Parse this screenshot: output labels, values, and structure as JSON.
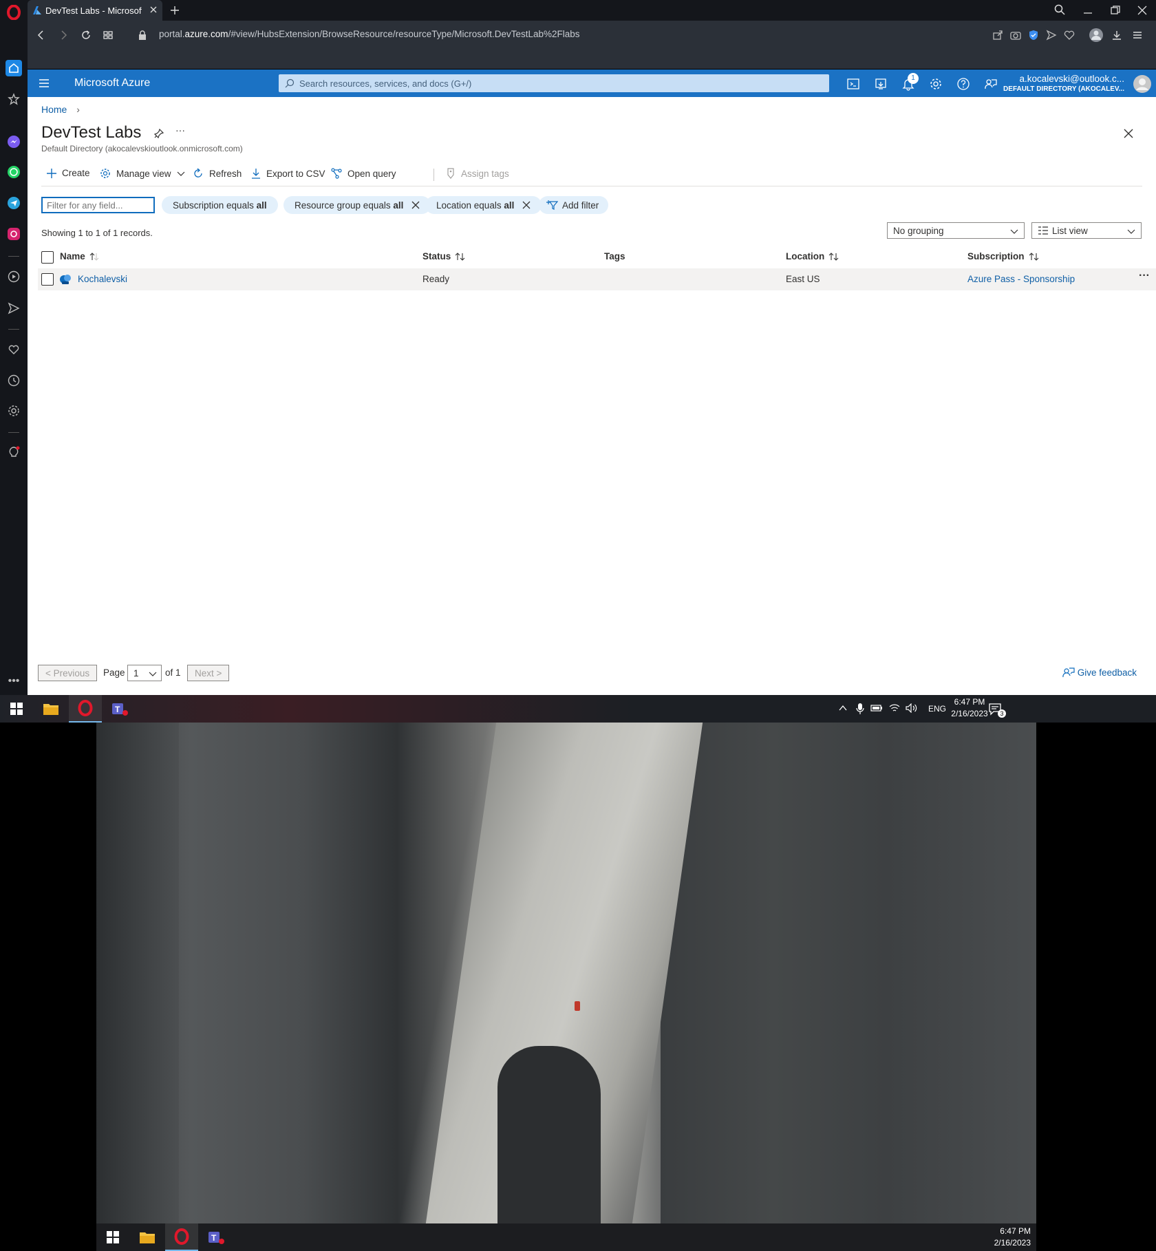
{
  "browser": {
    "tab_title": "DevTest Labs - Microsoft A",
    "url_prefix": "portal.",
    "url_domain": "azure.com",
    "url_rest": "/#view/HubsExtension/BrowseResource/resourceType/Microsoft.DevTestLab%2Flabs"
  },
  "azure_header": {
    "brand": "Microsoft Azure",
    "search_placeholder": "Search resources, services, and docs (G+/)",
    "notification_count": "1",
    "user_email": "a.kocalevski@outlook.c...",
    "user_directory": "DEFAULT DIRECTORY (AKOCALEV..."
  },
  "page": {
    "breadcrumb_home": "Home",
    "title": "DevTest Labs",
    "subtitle": "Default Directory (akocalevskioutlook.onmicrosoft.com)"
  },
  "toolbar": {
    "create": "Create",
    "manage_view": "Manage view",
    "refresh": "Refresh",
    "export_csv": "Export to CSV",
    "open_query": "Open query",
    "assign_tags": "Assign tags"
  },
  "filters": {
    "placeholder": "Filter for any field...",
    "subscription_label": "Subscription equals ",
    "subscription_value": "all",
    "resource_group_label": "Resource group equals ",
    "resource_group_value": "all",
    "location_label": "Location equals ",
    "location_value": "all",
    "add_filter": "Add filter"
  },
  "records_text": "Showing 1 to 1 of 1 records.",
  "grouping": "No grouping",
  "view_mode": "List view",
  "table": {
    "headers": {
      "name": "Name",
      "status": "Status",
      "tags": "Tags",
      "location": "Location",
      "subscription": "Subscription"
    },
    "rows": [
      {
        "name": "Kochalevski",
        "status": "Ready",
        "tags": "",
        "location": "East US",
        "subscription": "Azure Pass - Sponsorship"
      }
    ]
  },
  "pager": {
    "previous": "< Previous",
    "page_label": "Page",
    "page_value": "1",
    "of_label": "of 1",
    "next": "Next >"
  },
  "feedback": "Give feedback",
  "taskbar": {
    "language": "ENG",
    "time": "6:47 PM",
    "date": "2/16/2023",
    "notification_count": "3"
  },
  "taskbar_inner": {
    "time": "6:47 PM",
    "date": "2/16/2023"
  }
}
